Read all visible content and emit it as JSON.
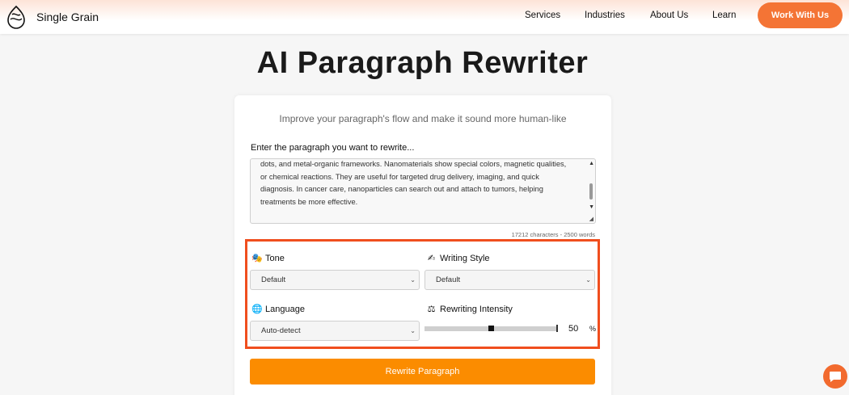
{
  "header": {
    "brand": "Single Grain",
    "nav": [
      "Services",
      "Industries",
      "About Us",
      "Learn"
    ],
    "cta_label": "Work With Us"
  },
  "page": {
    "title": "AI Paragraph Rewriter",
    "subtitle": "Improve your paragraph's flow and make it sound more human-like"
  },
  "input": {
    "label": "Enter the paragraph you want to rewrite...",
    "lines": [
      "dots, and metal-organic frameworks. Nanomaterials show special colors, magnetic qualities,",
      "or chemical reactions. They are useful for targeted drug delivery, imaging, and quick",
      "diagnosis. In cancer care, nanoparticles can search out and attach to tumors, helping",
      "treatments be more effective."
    ],
    "counter": "17212 characters - 2500 words"
  },
  "options": {
    "tone": {
      "label": "Tone",
      "value": "Default",
      "icon": "theater-masks-icon"
    },
    "style": {
      "label": "Writing Style",
      "value": "Default",
      "icon": "writing-hand-icon"
    },
    "language": {
      "label": "Language",
      "value": "Auto-detect",
      "icon": "globe-icon"
    },
    "intensity": {
      "label": "Rewriting Intensity",
      "value": 50,
      "value_label": "50",
      "unit": "%",
      "icon": "balance-scale-icon"
    }
  },
  "rewrite_button": "Rewrite Paragraph",
  "colors": {
    "accent": "#f47435",
    "button": "#fb8c00",
    "highlight_border": "#f04e1e"
  }
}
